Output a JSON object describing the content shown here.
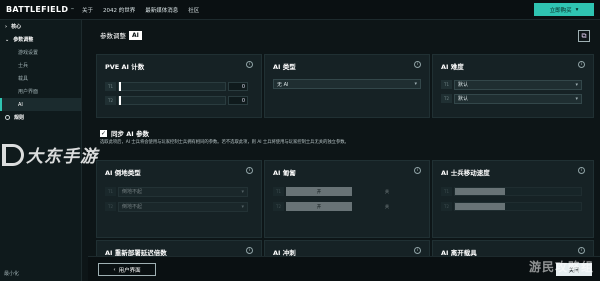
{
  "brand": {
    "title": "BATTLEFIELD",
    "suffix": "™"
  },
  "nav": {
    "items": [
      "关于",
      "2042 的世界",
      "最新媒体消息",
      "社区"
    ]
  },
  "topright": {
    "label": "立即购买"
  },
  "sidebar": {
    "items": [
      {
        "label": "核心",
        "type": "parent"
      },
      {
        "label": "参数调整",
        "type": "parent"
      },
      {
        "label": "游戏设置",
        "type": "sub"
      },
      {
        "label": "士兵",
        "type": "sub"
      },
      {
        "label": "载具",
        "type": "sub"
      },
      {
        "label": "用户界面",
        "type": "sub"
      },
      {
        "label": "AI",
        "type": "sub-active"
      },
      {
        "label": "规则",
        "type": "parent"
      }
    ],
    "bottom": "最小化"
  },
  "tabhead": {
    "label": "参数调整",
    "current": "AI"
  },
  "panels": {
    "pve_ai": {
      "title": "PVE AI 计数",
      "rows": [
        {
          "team": "T1",
          "value": "0"
        },
        {
          "team": "T2",
          "value": "0"
        }
      ]
    },
    "ai_type": {
      "title": "AI 类型",
      "value": "无 AI"
    },
    "ai_difficulty": {
      "title": "AI 难度",
      "rows": [
        {
          "team": "T1",
          "value": "默认"
        },
        {
          "team": "T2",
          "value": "默认"
        }
      ]
    },
    "ai_faction": {
      "title": "AI 倒地类型",
      "rows": [
        {
          "team": "T1",
          "value": "倒地不起"
        },
        {
          "team": "T2",
          "value": "倒地不起"
        }
      ]
    },
    "ai_crouch": {
      "title": "AI 匍匐",
      "rows": [
        {
          "team": "T1",
          "on": "开",
          "off": "关"
        },
        {
          "team": "T2",
          "on": "开",
          "off": "关"
        }
      ]
    },
    "ai_speed": {
      "title": "AI 士兵移动速度",
      "rows": [
        {
          "team": "T1",
          "fill": 0.4
        },
        {
          "team": "T2",
          "fill": 0.4
        }
      ]
    },
    "respawn": {
      "title": "AI 重新部署延迟倍数"
    },
    "sprint": {
      "title": "AI 冲刺"
    },
    "exit_vehicle": {
      "title": "AI 离开载具"
    }
  },
  "sync": {
    "label": "同步 AI 参数",
    "desc": "选取此项后，AI 士兵将会使用与玩家控制士兵拥有相同的参数。若不选取此项，则 AI 士兵将使用与玩家控制士兵无关的独立参数。"
  },
  "footer": {
    "ui_button": "用户界面",
    "close_button": "关闭"
  },
  "watermarks": {
    "left": "大东手游",
    "right": "游民攻略组"
  }
}
